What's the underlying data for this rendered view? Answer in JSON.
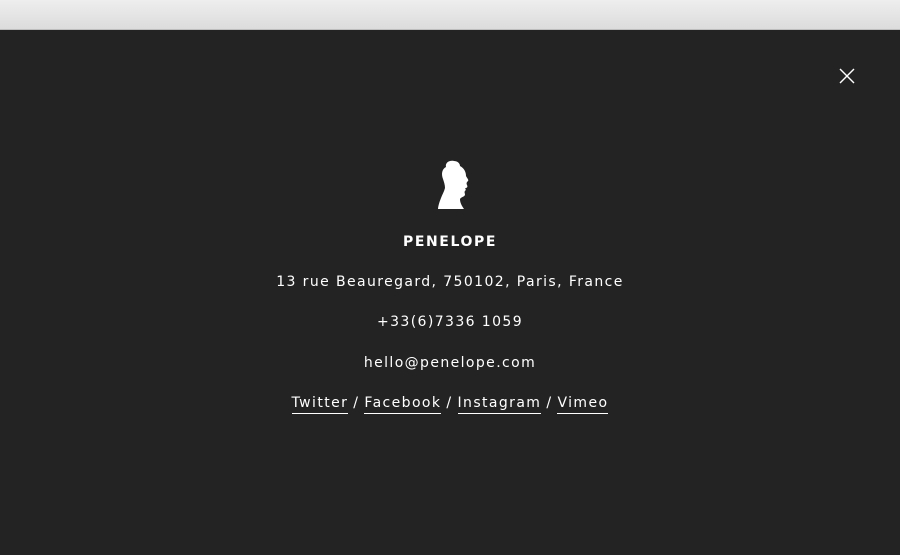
{
  "overlay": {
    "name": "PENELOPE",
    "address": "13 rue Beauregard, 750102, Paris, France",
    "phone": "+33(6)7336 1059",
    "email": "hello@penelope.com",
    "social": {
      "twitter": "Twitter",
      "facebook": "Facebook",
      "instagram": "Instagram",
      "vimeo": "Vimeo",
      "separator": "/"
    },
    "icons": {
      "close": "close-icon",
      "avatar": "woman-silhouette-icon"
    }
  },
  "colors": {
    "overlay_bg": "#232323",
    "text": "#ffffff",
    "browser_bar": "#e5e5e5"
  }
}
